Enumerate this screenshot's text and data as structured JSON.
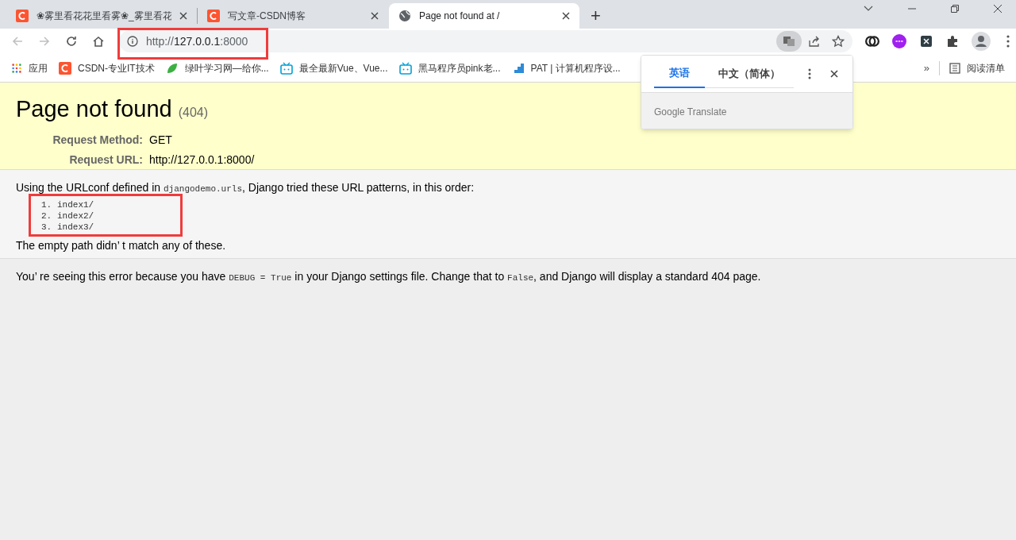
{
  "tabs": [
    {
      "title": "❀雾里看花花里看雾❀_雾里看花",
      "kind": "csdn",
      "selected": false
    },
    {
      "title": "写文章-CSDN博客",
      "kind": "csdn",
      "selected": false
    },
    {
      "title": "Page not found at /",
      "kind": "globe",
      "selected": true
    }
  ],
  "new_tab": "+",
  "address_bar": {
    "scheme": "http://",
    "host": "127.0.0.1",
    "port": ":8000"
  },
  "bookmarks": [
    {
      "label": "应用",
      "kind": "apps"
    },
    {
      "label": "CSDN-专业IT技术",
      "kind": "csdn"
    },
    {
      "label": "绿叶学习网—给你...",
      "kind": "leaf"
    },
    {
      "label": "最全最新Vue、Vue...",
      "kind": "tv"
    },
    {
      "label": "黑马程序员pink老...",
      "kind": "tv"
    },
    {
      "label": "PAT | 计算机程序设...",
      "kind": "pat"
    }
  ],
  "bookmarks_overflow": "»",
  "reading_list": "阅读清单",
  "translate_popup": {
    "tabs": [
      {
        "label": "英语",
        "selected": true
      },
      {
        "label": "中文（简体）",
        "selected": false
      }
    ],
    "footer": "Google Translate"
  },
  "page": {
    "title": "Page not found",
    "code": "(404)",
    "meta": [
      {
        "label": "Request Method:",
        "value": "GET"
      },
      {
        "label": "Request URL:",
        "value": "http://127.0.0.1:8000/"
      }
    ],
    "intro": [
      {
        "text": "Using the URLconf defined in ",
        "code": false
      },
      {
        "text": "djangodemo.urls",
        "code": true
      },
      {
        "text": ", Django tried these URL patterns, in this order:",
        "code": false
      }
    ],
    "patterns": [
      {
        "number": "1.",
        "pattern": "index1/"
      },
      {
        "number": "2.",
        "pattern": "index2/"
      },
      {
        "number": "3.",
        "pattern": "index3/"
      }
    ],
    "no_match": "The empty path didn’ t match any of these.",
    "explanation": [
      {
        "text": "You’ re seeing this error because you have ",
        "code": false
      },
      {
        "text": "DEBUG = True",
        "code": true
      },
      {
        "text": " in your Django settings file. Change that to ",
        "code": false
      },
      {
        "text": "False",
        "code": true
      },
      {
        "text": ", and Django will display a standard 404 page.",
        "code": false
      }
    ]
  },
  "annotations": [
    {
      "kind": "highlight"
    },
    {
      "kind": "highlight"
    }
  ]
}
